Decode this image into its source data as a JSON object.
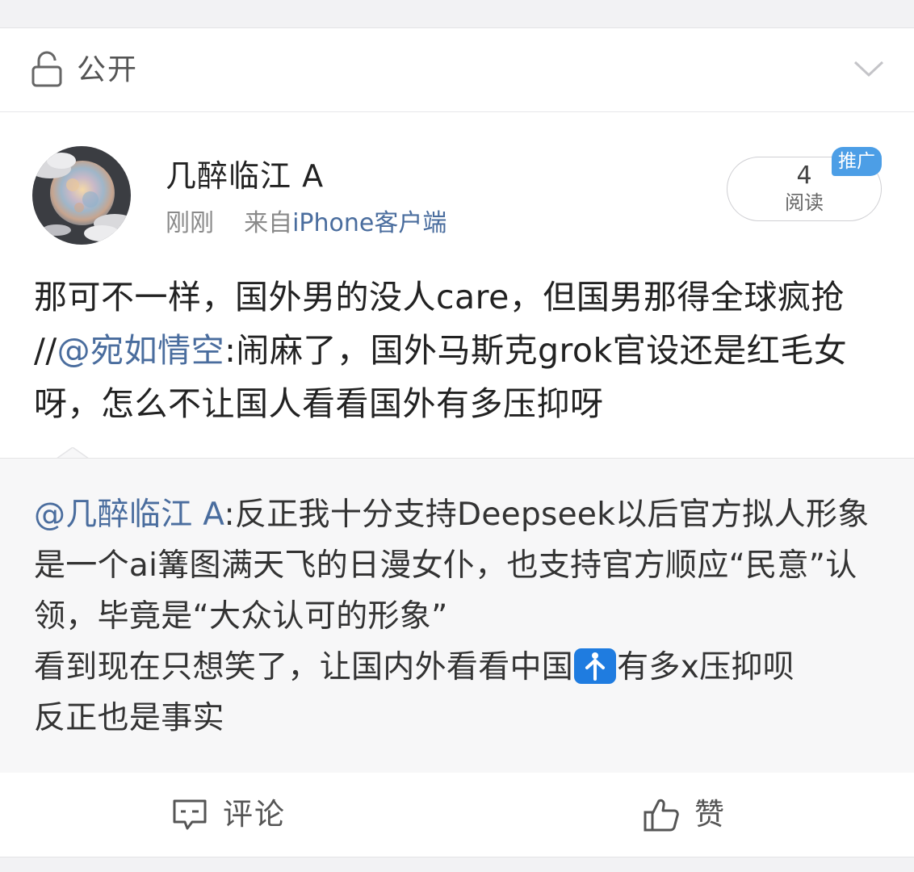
{
  "privacy": {
    "label": "公开",
    "icon": "lock-icon",
    "expand_icon": "chevron-down-icon"
  },
  "post": {
    "author": "几醉临江 A",
    "time": "刚刚",
    "source_prefix": "来自",
    "source": "iPhone客户端",
    "read_count": "4",
    "read_label": "阅读",
    "promo_badge": "推广",
    "body_text": "那可不一样，国外男的没人care，但国男那得全球疯抢 //",
    "body_mention": "@宛如情空",
    "body_text_after": ":闹麻了，国外马斯克grok官设还是红毛女呀，怎么不让国人看看国外有多压抑呀"
  },
  "quote": {
    "mention": "@几醉临江 A",
    "text": ":反正我十分支持Deepseek以后官方拟人形象是一个ai篝图满天飞的日漫女仆，也支持官方顺应“民意”认领，毕竟是“大众认可的形象”",
    "line2_before": "看到现在只想笑了，让国内外看看中国",
    "emoji": "person-up-arrow-emoji",
    "line2_after": "有多x压抑呗",
    "line3": "反正也是事实"
  },
  "actions": {
    "comment_label": "评论",
    "like_label": "赞"
  },
  "colors": {
    "link": "#4a6d9e",
    "badge": "#4c9ee6",
    "emoji_bg": "#1f7ce0"
  }
}
